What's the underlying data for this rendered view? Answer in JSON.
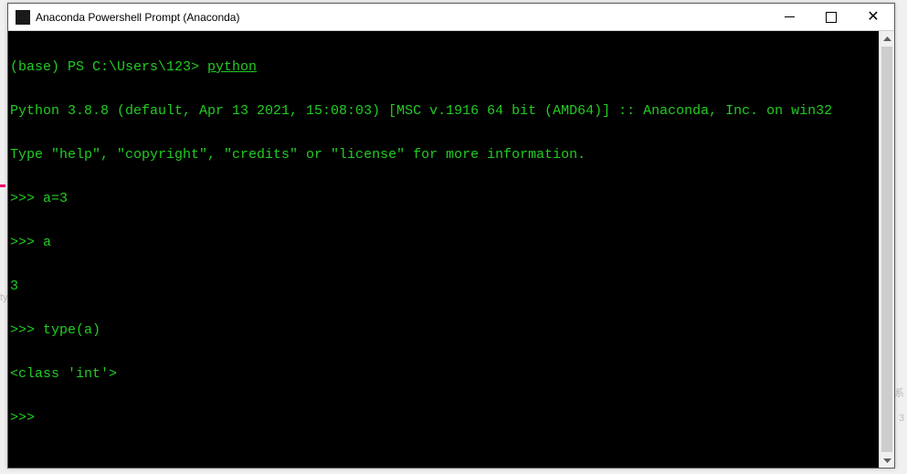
{
  "window": {
    "title": "Anaconda Powershell Prompt (Anaconda)"
  },
  "terminal": {
    "lines": [
      {
        "prefix": "(base) PS C:\\Users\\123> ",
        "cmd": "python"
      },
      {
        "text": "Python 3.8.8 (default, Apr 13 2021, 15:08:03) [MSC v.1916 64 bit (AMD64)] :: Anaconda, Inc. on win32"
      },
      {
        "text": "Type \"help\", \"copyright\", \"credits\" or \"license\" for more information."
      },
      {
        "text": ">>> a=3"
      },
      {
        "text": ">>> a"
      },
      {
        "text": "3"
      },
      {
        "text": ">>> type(a)"
      },
      {
        "text": "<class 'int'>"
      },
      {
        "text": ">>> "
      }
    ]
  },
  "bgnoise": {
    "n1": "ty",
    "n2": "系",
    "n3": "3"
  }
}
